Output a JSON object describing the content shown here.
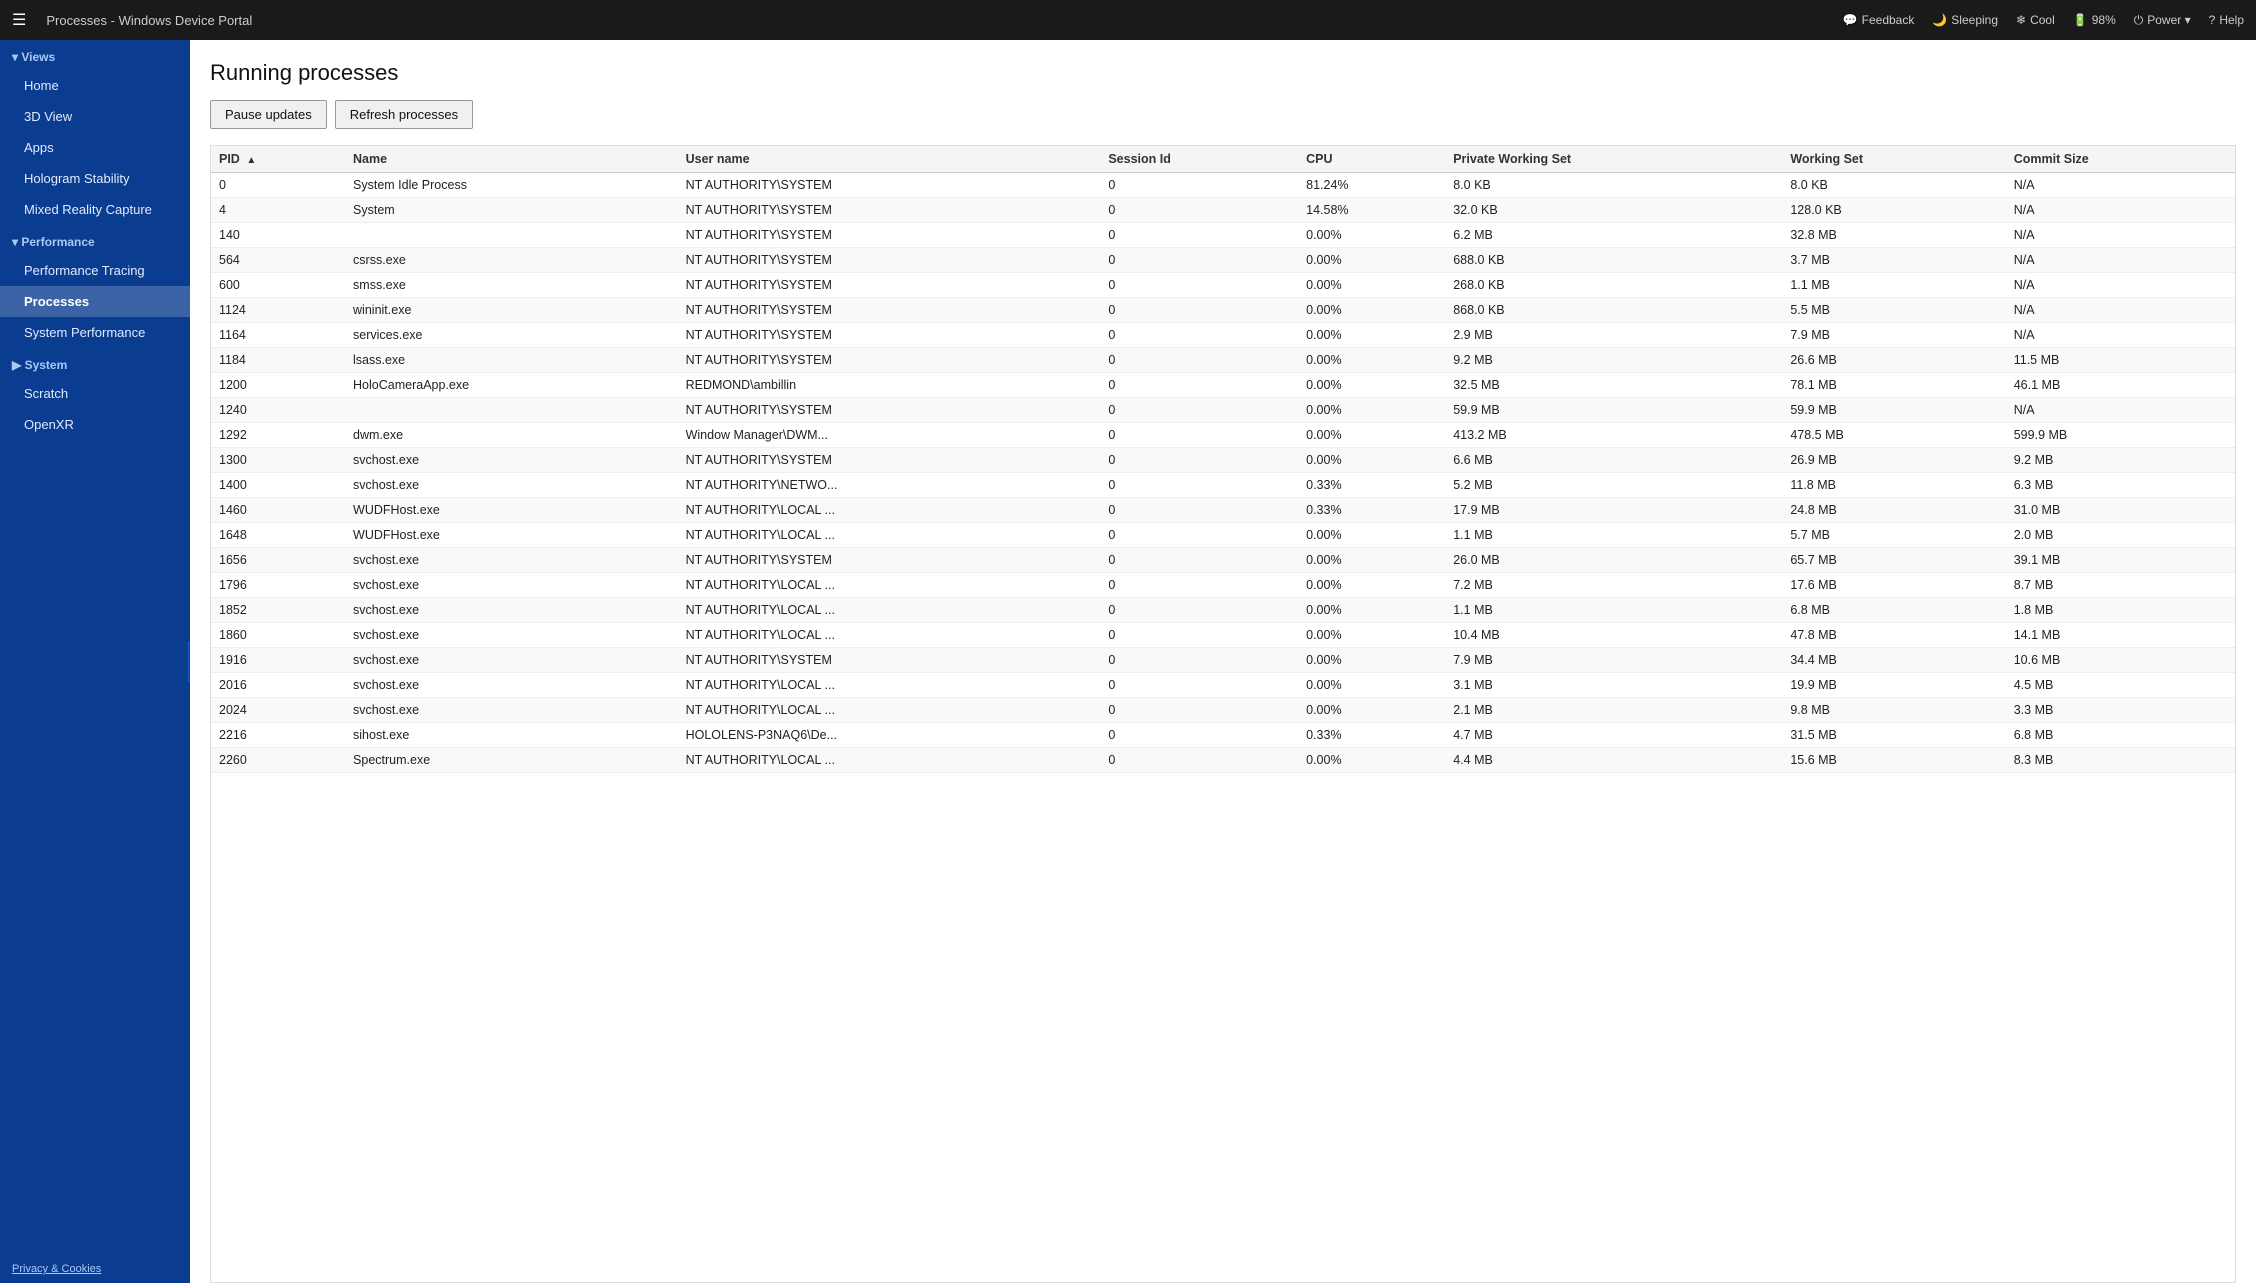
{
  "topbar": {
    "menu_icon": "☰",
    "title": "Processes - Windows Device Portal",
    "actions": [
      {
        "id": "feedback",
        "icon": "💬",
        "label": "Feedback"
      },
      {
        "id": "sleeping",
        "icon": "🌙",
        "label": "Sleeping"
      },
      {
        "id": "cool",
        "icon": "❄",
        "label": "Cool"
      },
      {
        "id": "battery",
        "icon": "🔋",
        "label": "98%"
      },
      {
        "id": "power",
        "icon": "⏻",
        "label": "Power ▾"
      },
      {
        "id": "help",
        "icon": "?",
        "label": "Help"
      }
    ]
  },
  "sidebar": {
    "collapse_icon": "◀",
    "sections": [
      {
        "label": "▾ Views",
        "items": [
          {
            "id": "home",
            "label": "Home",
            "active": false
          },
          {
            "id": "3d-view",
            "label": "3D View",
            "active": false
          },
          {
            "id": "apps",
            "label": "Apps",
            "active": false
          },
          {
            "id": "hologram-stability",
            "label": "Hologram Stability",
            "active": false
          },
          {
            "id": "mixed-reality-capture",
            "label": "Mixed Reality Capture",
            "active": false
          }
        ]
      },
      {
        "label": "▾ Performance",
        "items": [
          {
            "id": "performance-tracing",
            "label": "Performance Tracing",
            "active": false
          },
          {
            "id": "processes",
            "label": "Processes",
            "active": true
          },
          {
            "id": "system-performance",
            "label": "System Performance",
            "active": false
          }
        ]
      },
      {
        "label": "▶ System",
        "items": []
      },
      {
        "label": "Scratch",
        "items": [],
        "is_item": true
      },
      {
        "label": "OpenXR",
        "items": [],
        "is_item": true
      }
    ],
    "footer": "Privacy & Cookies"
  },
  "page": {
    "title": "Running processes",
    "buttons": {
      "pause": "Pause updates",
      "refresh": "Refresh processes"
    }
  },
  "table": {
    "columns": [
      {
        "id": "pid",
        "label": "PID",
        "sorted": true,
        "sort_dir": "asc"
      },
      {
        "id": "name",
        "label": "Name"
      },
      {
        "id": "username",
        "label": "User name"
      },
      {
        "id": "session_id",
        "label": "Session Id"
      },
      {
        "id": "cpu",
        "label": "CPU"
      },
      {
        "id": "private_working_set",
        "label": "Private Working Set"
      },
      {
        "id": "working_set",
        "label": "Working Set"
      },
      {
        "id": "commit_size",
        "label": "Commit Size"
      }
    ],
    "rows": [
      {
        "pid": "0",
        "name": "System Idle Process",
        "username": "NT AUTHORITY\\SYSTEM",
        "session_id": "0",
        "cpu": "81.24%",
        "private_working_set": "8.0 KB",
        "working_set": "8.0 KB",
        "commit_size": "N/A"
      },
      {
        "pid": "4",
        "name": "System",
        "username": "NT AUTHORITY\\SYSTEM",
        "session_id": "0",
        "cpu": "14.58%",
        "private_working_set": "32.0 KB",
        "working_set": "128.0 KB",
        "commit_size": "N/A"
      },
      {
        "pid": "140",
        "name": "",
        "username": "NT AUTHORITY\\SYSTEM",
        "session_id": "0",
        "cpu": "0.00%",
        "private_working_set": "6.2 MB",
        "working_set": "32.8 MB",
        "commit_size": "N/A"
      },
      {
        "pid": "564",
        "name": "csrss.exe",
        "username": "NT AUTHORITY\\SYSTEM",
        "session_id": "0",
        "cpu": "0.00%",
        "private_working_set": "688.0 KB",
        "working_set": "3.7 MB",
        "commit_size": "N/A"
      },
      {
        "pid": "600",
        "name": "smss.exe",
        "username": "NT AUTHORITY\\SYSTEM",
        "session_id": "0",
        "cpu": "0.00%",
        "private_working_set": "268.0 KB",
        "working_set": "1.1 MB",
        "commit_size": "N/A"
      },
      {
        "pid": "1124",
        "name": "wininit.exe",
        "username": "NT AUTHORITY\\SYSTEM",
        "session_id": "0",
        "cpu": "0.00%",
        "private_working_set": "868.0 KB",
        "working_set": "5.5 MB",
        "commit_size": "N/A"
      },
      {
        "pid": "1164",
        "name": "services.exe",
        "username": "NT AUTHORITY\\SYSTEM",
        "session_id": "0",
        "cpu": "0.00%",
        "private_working_set": "2.9 MB",
        "working_set": "7.9 MB",
        "commit_size": "N/A"
      },
      {
        "pid": "1184",
        "name": "lsass.exe",
        "username": "NT AUTHORITY\\SYSTEM",
        "session_id": "0",
        "cpu": "0.00%",
        "private_working_set": "9.2 MB",
        "working_set": "26.6 MB",
        "commit_size": "11.5 MB"
      },
      {
        "pid": "1200",
        "name": "HoloCameraApp.exe",
        "username": "REDMOND\\ambillin",
        "session_id": "0",
        "cpu": "0.00%",
        "private_working_set": "32.5 MB",
        "working_set": "78.1 MB",
        "commit_size": "46.1 MB"
      },
      {
        "pid": "1240",
        "name": "",
        "username": "NT AUTHORITY\\SYSTEM",
        "session_id": "0",
        "cpu": "0.00%",
        "private_working_set": "59.9 MB",
        "working_set": "59.9 MB",
        "commit_size": "N/A"
      },
      {
        "pid": "1292",
        "name": "dwm.exe",
        "username": "Window Manager\\DWM...",
        "session_id": "0",
        "cpu": "0.00%",
        "private_working_set": "413.2 MB",
        "working_set": "478.5 MB",
        "commit_size": "599.9 MB"
      },
      {
        "pid": "1300",
        "name": "svchost.exe",
        "username": "NT AUTHORITY\\SYSTEM",
        "session_id": "0",
        "cpu": "0.00%",
        "private_working_set": "6.6 MB",
        "working_set": "26.9 MB",
        "commit_size": "9.2 MB"
      },
      {
        "pid": "1400",
        "name": "svchost.exe",
        "username": "NT AUTHORITY\\NETWO...",
        "session_id": "0",
        "cpu": "0.33%",
        "private_working_set": "5.2 MB",
        "working_set": "11.8 MB",
        "commit_size": "6.3 MB"
      },
      {
        "pid": "1460",
        "name": "WUDFHost.exe",
        "username": "NT AUTHORITY\\LOCAL ...",
        "session_id": "0",
        "cpu": "0.33%",
        "private_working_set": "17.9 MB",
        "working_set": "24.8 MB",
        "commit_size": "31.0 MB"
      },
      {
        "pid": "1648",
        "name": "WUDFHost.exe",
        "username": "NT AUTHORITY\\LOCAL ...",
        "session_id": "0",
        "cpu": "0.00%",
        "private_working_set": "1.1 MB",
        "working_set": "5.7 MB",
        "commit_size": "2.0 MB"
      },
      {
        "pid": "1656",
        "name": "svchost.exe",
        "username": "NT AUTHORITY\\SYSTEM",
        "session_id": "0",
        "cpu": "0.00%",
        "private_working_set": "26.0 MB",
        "working_set": "65.7 MB",
        "commit_size": "39.1 MB"
      },
      {
        "pid": "1796",
        "name": "svchost.exe",
        "username": "NT AUTHORITY\\LOCAL ...",
        "session_id": "0",
        "cpu": "0.00%",
        "private_working_set": "7.2 MB",
        "working_set": "17.6 MB",
        "commit_size": "8.7 MB"
      },
      {
        "pid": "1852",
        "name": "svchost.exe",
        "username": "NT AUTHORITY\\LOCAL ...",
        "session_id": "0",
        "cpu": "0.00%",
        "private_working_set": "1.1 MB",
        "working_set": "6.8 MB",
        "commit_size": "1.8 MB"
      },
      {
        "pid": "1860",
        "name": "svchost.exe",
        "username": "NT AUTHORITY\\LOCAL ...",
        "session_id": "0",
        "cpu": "0.00%",
        "private_working_set": "10.4 MB",
        "working_set": "47.8 MB",
        "commit_size": "14.1 MB"
      },
      {
        "pid": "1916",
        "name": "svchost.exe",
        "username": "NT AUTHORITY\\SYSTEM",
        "session_id": "0",
        "cpu": "0.00%",
        "private_working_set": "7.9 MB",
        "working_set": "34.4 MB",
        "commit_size": "10.6 MB"
      },
      {
        "pid": "2016",
        "name": "svchost.exe",
        "username": "NT AUTHORITY\\LOCAL ...",
        "session_id": "0",
        "cpu": "0.00%",
        "private_working_set": "3.1 MB",
        "working_set": "19.9 MB",
        "commit_size": "4.5 MB"
      },
      {
        "pid": "2024",
        "name": "svchost.exe",
        "username": "NT AUTHORITY\\LOCAL ...",
        "session_id": "0",
        "cpu": "0.00%",
        "private_working_set": "2.1 MB",
        "working_set": "9.8 MB",
        "commit_size": "3.3 MB"
      },
      {
        "pid": "2216",
        "name": "sihost.exe",
        "username": "HOLOLENS-P3NAQ6\\De...",
        "session_id": "0",
        "cpu": "0.33%",
        "private_working_set": "4.7 MB",
        "working_set": "31.5 MB",
        "commit_size": "6.8 MB"
      },
      {
        "pid": "2260",
        "name": "Spectrum.exe",
        "username": "NT AUTHORITY\\LOCAL ...",
        "session_id": "0",
        "cpu": "0.00%",
        "private_working_set": "4.4 MB",
        "working_set": "15.6 MB",
        "commit_size": "8.3 MB"
      }
    ]
  }
}
